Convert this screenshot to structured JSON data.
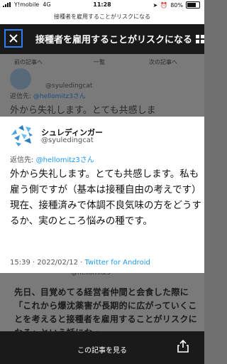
{
  "status_bar": {
    "carrier": "Y!mobile",
    "network": "4G",
    "time": "11:28",
    "battery": "80%",
    "battery_level": 0.8
  },
  "page_url_text": "接種者を雇用することがリスクになる",
  "header": {
    "title": "接種者を雇用することがリスクになる"
  },
  "background": {
    "nav_prev": "前の記事へ",
    "nav_list": "一覧",
    "nav_next": "次の記事へ",
    "handle": "@syuledingcat",
    "reply_label": "返信先:",
    "reply_mention": "@hellomitz3さん",
    "text_line": "外から失礼します。とても共感しま",
    "handle2": "@hellomitz3",
    "article_text": "先日、目覚めてる経営者仲間と会食した際に「これから爆沈薬害が長期的に広がっていくことを考えると接種者を雇用することがリスクになる」という話になっ"
  },
  "tweet": {
    "name": "シュレディンガー",
    "handle": "@syuledingcat",
    "reply_label": "返信先:",
    "reply_mention": "@hellomitz3さん",
    "text": "外から失礼します。とても共感します。私も雇う側ですが（基本は接種自由の考えです）現在、接種済みで体調不良気味の方をどうするか、実のところ悩みの種です。",
    "time": "15:39 · 2022/02/12 · ",
    "source": "Twitter for Android"
  },
  "bottom_bar": {
    "label": "この記事を見る"
  },
  "colors": {
    "accent": "#2f7df7",
    "link": "#1d9bf0",
    "header_bg": "#1a1a1a"
  },
  "icons": [
    "close-icon",
    "grid-icon",
    "share-icon",
    "avatar-icon",
    "signal-icon",
    "battery-icon"
  ]
}
